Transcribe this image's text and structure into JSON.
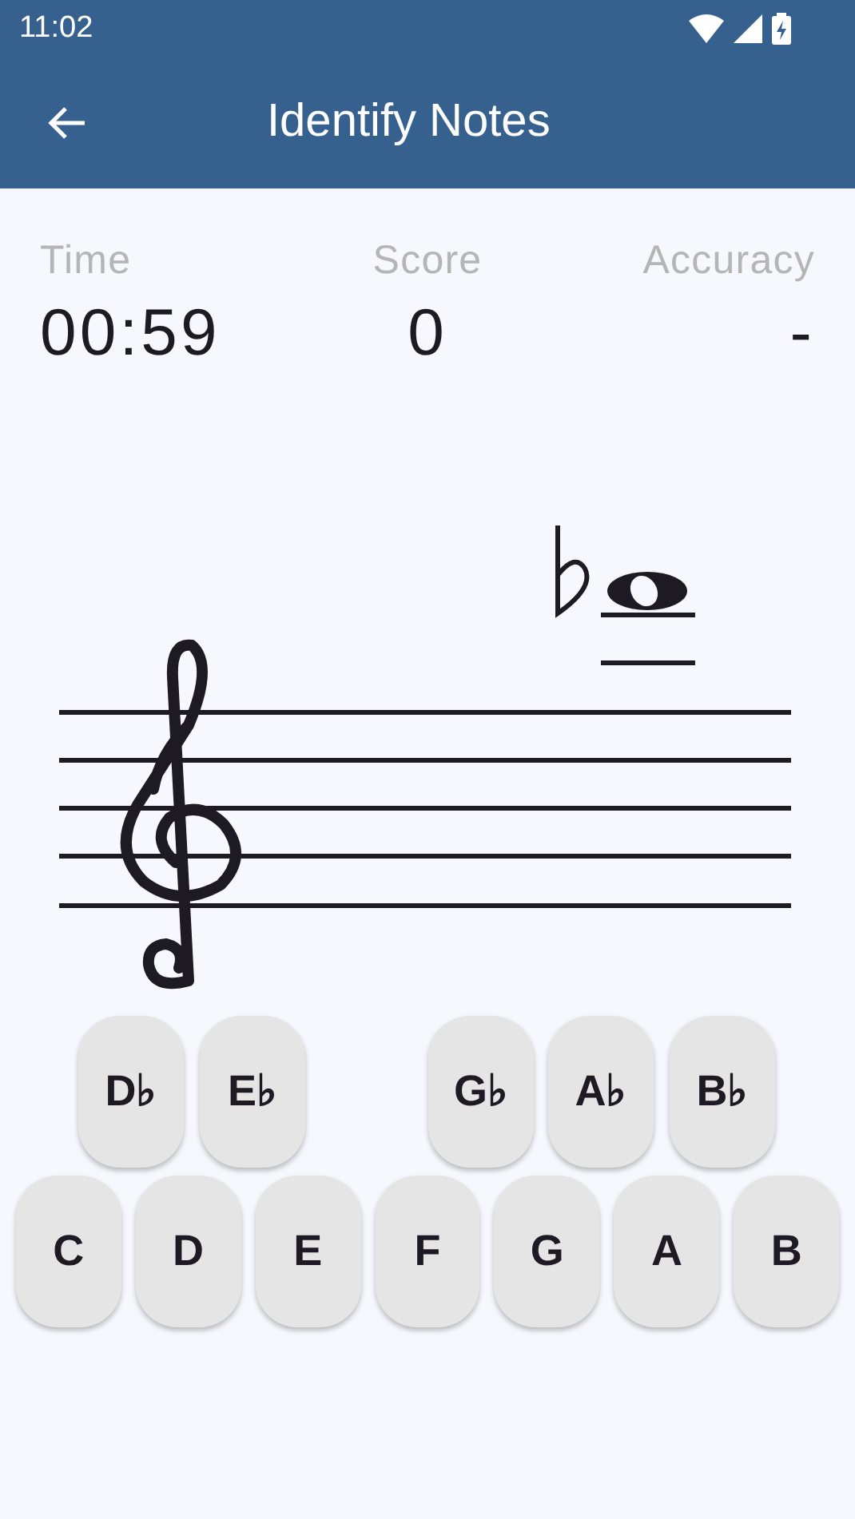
{
  "status_bar": {
    "time": "11:02"
  },
  "app_bar": {
    "title": "Identify Notes"
  },
  "stats": [
    {
      "label": "Time",
      "value": "00:59"
    },
    {
      "label": "Score",
      "value": "0"
    },
    {
      "label": "Accuracy",
      "value": "-"
    }
  ],
  "flat_keys": [
    "D♭",
    "E♭",
    "G♭",
    "A♭",
    "B♭"
  ],
  "natural_keys": [
    "C",
    "D",
    "E",
    "F",
    "G",
    "A",
    "B"
  ]
}
